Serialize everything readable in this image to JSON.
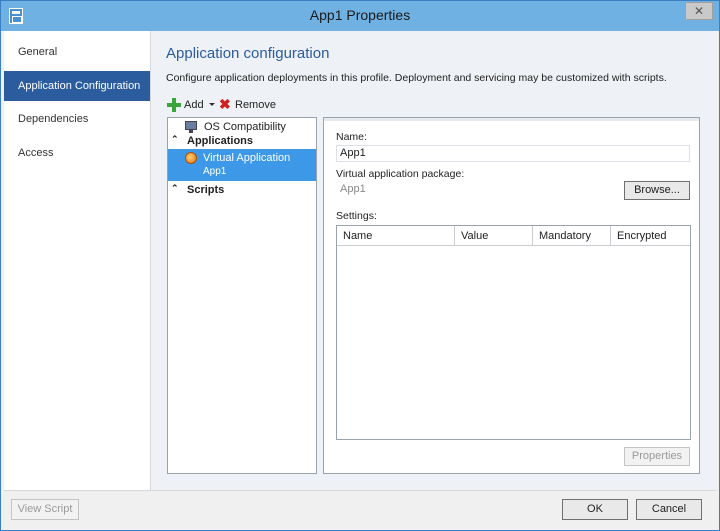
{
  "window": {
    "title": "App1 Properties",
    "close_glyph": "✕"
  },
  "nav": {
    "items": [
      {
        "label": "General"
      },
      {
        "label": "Application Configuration"
      },
      {
        "label": "Dependencies"
      },
      {
        "label": "Access"
      }
    ],
    "selected_index": 1
  },
  "content": {
    "heading": "Application configuration",
    "description": "Configure application deployments in this profile. Deployment and servicing may be customized with scripts."
  },
  "toolbar": {
    "add_label": "Add",
    "remove_label": "Remove"
  },
  "tree": {
    "os_compat": "OS Compatibility",
    "applications": "Applications",
    "virtual_app_title": "Virtual Application",
    "virtual_app_sub": "App1",
    "scripts": "Scripts",
    "collapse_glyph": "⌃"
  },
  "details": {
    "name_label": "Name:",
    "name_value": "App1",
    "package_label": "Virtual application package:",
    "package_value": "App1",
    "browse_label": "Browse...",
    "settings_label": "Settings:",
    "columns": [
      "Name",
      "Value",
      "Mandatory",
      "Encrypted"
    ],
    "properties_label": "Properties"
  },
  "footer": {
    "view_script": "View Script",
    "ok": "OK",
    "cancel": "Cancel"
  },
  "colors": {
    "accent": "#2a5c9e",
    "selection": "#3d98e8",
    "titlebar": "#6fb1e3"
  }
}
